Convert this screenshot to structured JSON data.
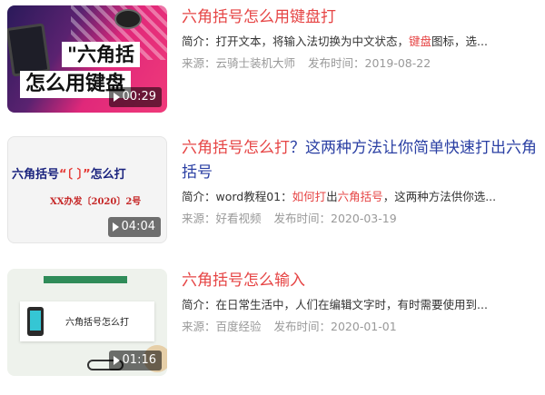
{
  "results": [
    {
      "title_parts": [
        {
          "text": "六角括号怎么用键盘打",
          "kw": true
        }
      ],
      "desc_parts": [
        {
          "text": "简介：打开文本，将输入法切换为中文状态，",
          "kw": false
        },
        {
          "text": "键盘",
          "kw": true
        },
        {
          "text": "图标，选...",
          "kw": false
        }
      ],
      "source": "来源：云骑士装机大师",
      "date": "发布时间：2019-08-22",
      "duration": "00:29",
      "thumb_text": [
        "\"六角括",
        "怎么用键盘"
      ]
    },
    {
      "title_parts": [
        {
          "text": "六角括号怎么打",
          "kw": true
        },
        {
          "text": "？这两种方法让你简单快速打出六角括号",
          "kw": false
        }
      ],
      "desc_parts": [
        {
          "text": "简介：word教程01：",
          "kw": false
        },
        {
          "text": "如何打",
          "kw": true
        },
        {
          "text": "出",
          "kw": false
        },
        {
          "text": "六角括号",
          "kw": true
        },
        {
          "text": "，这两种方法供你选...",
          "kw": false
        }
      ],
      "source": "来源：好看视频",
      "date": "发布时间：2020-03-19",
      "duration": "04:04",
      "thumb_text": [
        "六角括号",
        "“〔 〕”",
        "怎么打",
        "XX办发〔2020〕2号"
      ]
    },
    {
      "title_parts": [
        {
          "text": "六角括号怎么",
          "kw": true
        },
        {
          "text": "输入",
          "kw": false
        }
      ],
      "desc_parts": [
        {
          "text": "简介：在日常生活中，人们在编辑文字时，有时需要使用到...",
          "kw": false
        }
      ],
      "source": "来源：百度经验",
      "date": "发布时间：2020-01-01",
      "duration": "01:16",
      "thumb_text": [
        "六角括号怎么打"
      ]
    }
  ]
}
